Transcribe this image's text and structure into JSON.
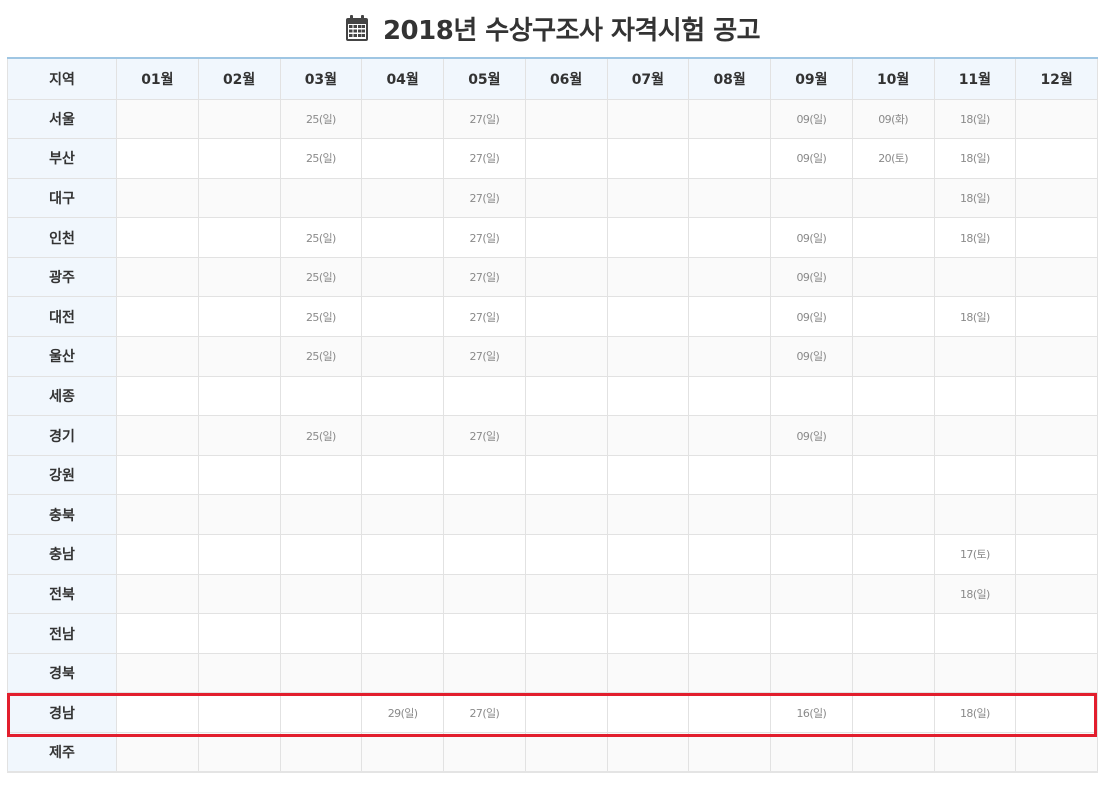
{
  "header": {
    "title": "2018년 수상구조사 자격시험 공고",
    "icon": "calendar-icon"
  },
  "table": {
    "region_header": "지역",
    "months": [
      "01월",
      "02월",
      "03월",
      "04월",
      "05월",
      "06월",
      "07월",
      "08월",
      "09월",
      "10월",
      "11월",
      "12월"
    ],
    "rows": [
      {
        "region": "서울",
        "cells": [
          "",
          "",
          "25(일)",
          "",
          "27(일)",
          "",
          "",
          "",
          "09(일)",
          "09(화)",
          "18(일)",
          ""
        ]
      },
      {
        "region": "부산",
        "cells": [
          "",
          "",
          "25(일)",
          "",
          "27(일)",
          "",
          "",
          "",
          "09(일)",
          "20(토)",
          "18(일)",
          ""
        ]
      },
      {
        "region": "대구",
        "cells": [
          "",
          "",
          "",
          "",
          "27(일)",
          "",
          "",
          "",
          "",
          "",
          "18(일)",
          ""
        ]
      },
      {
        "region": "인천",
        "cells": [
          "",
          "",
          "25(일)",
          "",
          "27(일)",
          "",
          "",
          "",
          "09(일)",
          "",
          "18(일)",
          ""
        ]
      },
      {
        "region": "광주",
        "cells": [
          "",
          "",
          "25(일)",
          "",
          "27(일)",
          "",
          "",
          "",
          "09(일)",
          "",
          "",
          ""
        ]
      },
      {
        "region": "대전",
        "cells": [
          "",
          "",
          "25(일)",
          "",
          "27(일)",
          "",
          "",
          "",
          "09(일)",
          "",
          "18(일)",
          ""
        ]
      },
      {
        "region": "울산",
        "cells": [
          "",
          "",
          "25(일)",
          "",
          "27(일)",
          "",
          "",
          "",
          "09(일)",
          "",
          "",
          ""
        ]
      },
      {
        "region": "세종",
        "cells": [
          "",
          "",
          "",
          "",
          "",
          "",
          "",
          "",
          "",
          "",
          "",
          ""
        ]
      },
      {
        "region": "경기",
        "cells": [
          "",
          "",
          "25(일)",
          "",
          "27(일)",
          "",
          "",
          "",
          "09(일)",
          "",
          "",
          ""
        ]
      },
      {
        "region": "강원",
        "cells": [
          "",
          "",
          "",
          "",
          "",
          "",
          "",
          "",
          "",
          "",
          "",
          ""
        ]
      },
      {
        "region": "충북",
        "cells": [
          "",
          "",
          "",
          "",
          "",
          "",
          "",
          "",
          "",
          "",
          "",
          ""
        ]
      },
      {
        "region": "충남",
        "cells": [
          "",
          "",
          "",
          "",
          "",
          "",
          "",
          "",
          "",
          "",
          "17(토)",
          ""
        ]
      },
      {
        "region": "전북",
        "cells": [
          "",
          "",
          "",
          "",
          "",
          "",
          "",
          "",
          "",
          "",
          "18(일)",
          ""
        ]
      },
      {
        "region": "전남",
        "cells": [
          "",
          "",
          "",
          "",
          "",
          "",
          "",
          "",
          "",
          "",
          "",
          ""
        ]
      },
      {
        "region": "경북",
        "cells": [
          "",
          "",
          "",
          "",
          "",
          "",
          "",
          "",
          "",
          "",
          "",
          ""
        ]
      },
      {
        "region": "경남",
        "cells": [
          "",
          "",
          "",
          "29(일)",
          "27(일)",
          "",
          "",
          "",
          "16(일)",
          "",
          "18(일)",
          ""
        ]
      },
      {
        "region": "제주",
        "cells": [
          "",
          "",
          "",
          "",
          "",
          "",
          "",
          "",
          "",
          "",
          "",
          ""
        ]
      }
    ]
  },
  "highlight": {
    "row_region": "경남",
    "color": "#e21e2d"
  },
  "colors": {
    "header_bg": "#f1f7fd",
    "top_border": "#9fc6e3",
    "cell_text": "#8a8a8a"
  }
}
